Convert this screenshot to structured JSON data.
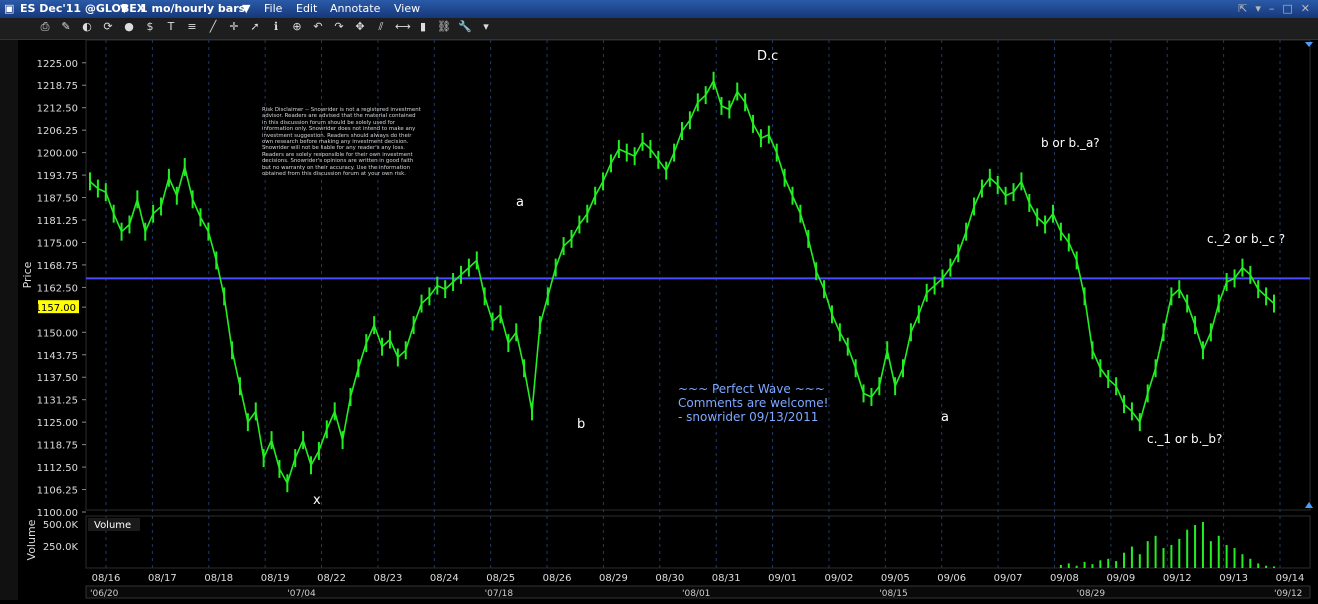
{
  "window": {
    "title": "ES Dec'11 @GLOBEX",
    "timeframe": "1 mo/hourly bars",
    "menu": [
      "File",
      "Edit",
      "Annotate",
      "View"
    ]
  },
  "toolbar": {
    "icons": [
      "print-icon",
      "draw-icon",
      "color-icon",
      "refresh-icon",
      "circle-icon",
      "dollar-icon",
      "text-icon",
      "fib-icon",
      "line-icon",
      "crosshair-icon",
      "cursor-icon",
      "info-icon",
      "zoom-icon",
      "undo-icon",
      "redo-icon",
      "pan-icon",
      "channel-icon",
      "measure-icon",
      "bar-icon",
      "link-icon",
      "wrench-icon",
      "dropdown-icon"
    ]
  },
  "price_axis": {
    "label": "Price",
    "ticks": [
      "1225.00",
      "1218.75",
      "1212.50",
      "1206.25",
      "1200.00",
      "1193.75",
      "1187.50",
      "1181.25",
      "1175.00",
      "1168.75",
      "1162.50",
      "1157.00",
      "1150.00",
      "1143.75",
      "1137.50",
      "1131.25",
      "1125.00",
      "1118.75",
      "1112.50",
      "1106.25",
      "1100.00"
    ],
    "current": "1157.00",
    "current_color": "#ffff00"
  },
  "volume": {
    "title": "Volume",
    "label": "Volume",
    "ticks": [
      "500.0K",
      "250.0K"
    ]
  },
  "date_axis": {
    "days": [
      "08/16",
      "08/17",
      "08/18",
      "08/19",
      "08/22",
      "08/23",
      "08/24",
      "08/25",
      "08/26",
      "08/29",
      "08/30",
      "08/31",
      "09/01",
      "09/02",
      "09/05",
      "09/06",
      "09/07",
      "09/08",
      "09/09",
      "09/12",
      "09/13",
      "09/14"
    ],
    "overview": [
      "'06/20",
      "'07/04",
      "'07/18",
      "'08/01",
      "'08/15",
      "'08/29",
      "'09/12"
    ]
  },
  "annotations": {
    "dc": "D.c",
    "a1": "a",
    "b1": "b",
    "x": "x",
    "a2": "a",
    "bora": "b or b._a?",
    "c1": "c._1 or b._b?",
    "c2": "c._2 or b._c ?"
  },
  "signature": {
    "line1": "~~~ Perfect Wave ~~~",
    "line2": "Comments are welcome!",
    "line3": "- snowrider  09/13/2011"
  },
  "disclaimer": "Risk Disclaimer -- Snowrider is not a registered investment advisor.  Readers are advised that the material contained in this discussion forum should be solely used for information only.  Snowrider does not intend to make any investment suggestion.  Readers should always do their own research before making any investment decision.  Snowrider will not be liable for any reader's any loss.  Readers are solely responsible for their own investment decisions.  Snowrider's opinions are written in good faith but no warranty on their accuracy.  Use the information obtained from this discussion forum  at your own risk.",
  "chart_data": {
    "type": "line",
    "ylabel": "Price",
    "ylim": [
      1100,
      1228
    ],
    "reference_line": 1165,
    "x": [
      0,
      1,
      2,
      3,
      4,
      5,
      6,
      7,
      8,
      9,
      10,
      11,
      12,
      13,
      14,
      15,
      16,
      17,
      18,
      19,
      20,
      21,
      22,
      23,
      24,
      25,
      26,
      27,
      28,
      29,
      30,
      31,
      32,
      33,
      34,
      35,
      36,
      37,
      38,
      39,
      40,
      41,
      42,
      43,
      44,
      45,
      46,
      47,
      48,
      49,
      50,
      51,
      52,
      53,
      54,
      55,
      56,
      57,
      58,
      59,
      60,
      61,
      62,
      63,
      64,
      65,
      66,
      67,
      68,
      69,
      70,
      71,
      72,
      73,
      74,
      75,
      76,
      77,
      78,
      79,
      80,
      81,
      82,
      83,
      84,
      85,
      86,
      87,
      88,
      89,
      90,
      91,
      92,
      93,
      94,
      95,
      96,
      97,
      98,
      99,
      100,
      101,
      102,
      103,
      104,
      105,
      106,
      107,
      108,
      109,
      110,
      111,
      112,
      113,
      114,
      115,
      116,
      117,
      118,
      119,
      120,
      121,
      122,
      123,
      124,
      125,
      126,
      127,
      128,
      129,
      130,
      131,
      132,
      133,
      134,
      135,
      136,
      137,
      138,
      139,
      140,
      141,
      142,
      143,
      144,
      145,
      146,
      147,
      148,
      149,
      150
    ],
    "series": [
      {
        "values": [
          1192,
          1190,
          1189,
          1183,
          1178,
          1180,
          1187,
          1178,
          1183,
          1185,
          1193,
          1188,
          1196,
          1187,
          1182,
          1178,
          1170,
          1160,
          1145,
          1135,
          1125,
          1128,
          1115,
          1120,
          1112,
          1108,
          1115,
          1120,
          1113,
          1117,
          1123,
          1128,
          1120,
          1132,
          1140,
          1147,
          1152,
          1146,
          1148,
          1143,
          1145,
          1152,
          1158,
          1160,
          1163,
          1162,
          1164,
          1166,
          1168,
          1170,
          1160,
          1153,
          1155,
          1147,
          1150,
          1140,
          1128,
          1152,
          1160,
          1168,
          1174,
          1176,
          1180,
          1183,
          1188,
          1192,
          1197,
          1201,
          1200,
          1199,
          1203,
          1201,
          1198,
          1195,
          1200,
          1206,
          1209,
          1214,
          1216,
          1220,
          1213,
          1212,
          1217,
          1214,
          1208,
          1204,
          1205,
          1200,
          1193,
          1188,
          1183,
          1176,
          1167,
          1162,
          1155,
          1150,
          1146,
          1140,
          1133,
          1132,
          1135,
          1145,
          1135,
          1140,
          1150,
          1155,
          1161,
          1163,
          1165,
          1168,
          1172,
          1178,
          1185,
          1190,
          1193,
          1191,
          1188,
          1189,
          1192,
          1186,
          1182,
          1180,
          1183,
          1178,
          1175,
          1170,
          1160,
          1145,
          1140,
          1137,
          1135,
          1130,
          1128,
          1125,
          1133,
          1140,
          1150,
          1160,
          1162,
          1158,
          1152,
          1145,
          1150,
          1158,
          1164,
          1165,
          1168,
          1166,
          1162,
          1160,
          1158
        ]
      }
    ],
    "volume_values": [
      0,
      0,
      0,
      0,
      0,
      0,
      0,
      0,
      0,
      0,
      0,
      0,
      0,
      0,
      0,
      0,
      0,
      0,
      0,
      0,
      0,
      0,
      0,
      0,
      0,
      0,
      0,
      0,
      0,
      0,
      0,
      0,
      0,
      0,
      0,
      0,
      0,
      0,
      0,
      0,
      0,
      0,
      0,
      0,
      0,
      0,
      0,
      0,
      0,
      0,
      0,
      0,
      0,
      0,
      0,
      0,
      0,
      0,
      0,
      0,
      0,
      0,
      0,
      0,
      0,
      0,
      0,
      0,
      0,
      0,
      0,
      0,
      0,
      0,
      0,
      0,
      0,
      0,
      0,
      0,
      0,
      0,
      0,
      0,
      0,
      0,
      0,
      0,
      0,
      0,
      0,
      0,
      0,
      0,
      0,
      0,
      0,
      0,
      0,
      0,
      0,
      0,
      0,
      0,
      0,
      0,
      0,
      0,
      0,
      0,
      0,
      0,
      0,
      0,
      0,
      0,
      0,
      0,
      0,
      0,
      0,
      0,
      0,
      40,
      60,
      30,
      80,
      50,
      100,
      120,
      90,
      200,
      280,
      180,
      350,
      420,
      260,
      300,
      380,
      500,
      560,
      600,
      350,
      420,
      300,
      260,
      180,
      120,
      60,
      30,
      20
    ]
  }
}
